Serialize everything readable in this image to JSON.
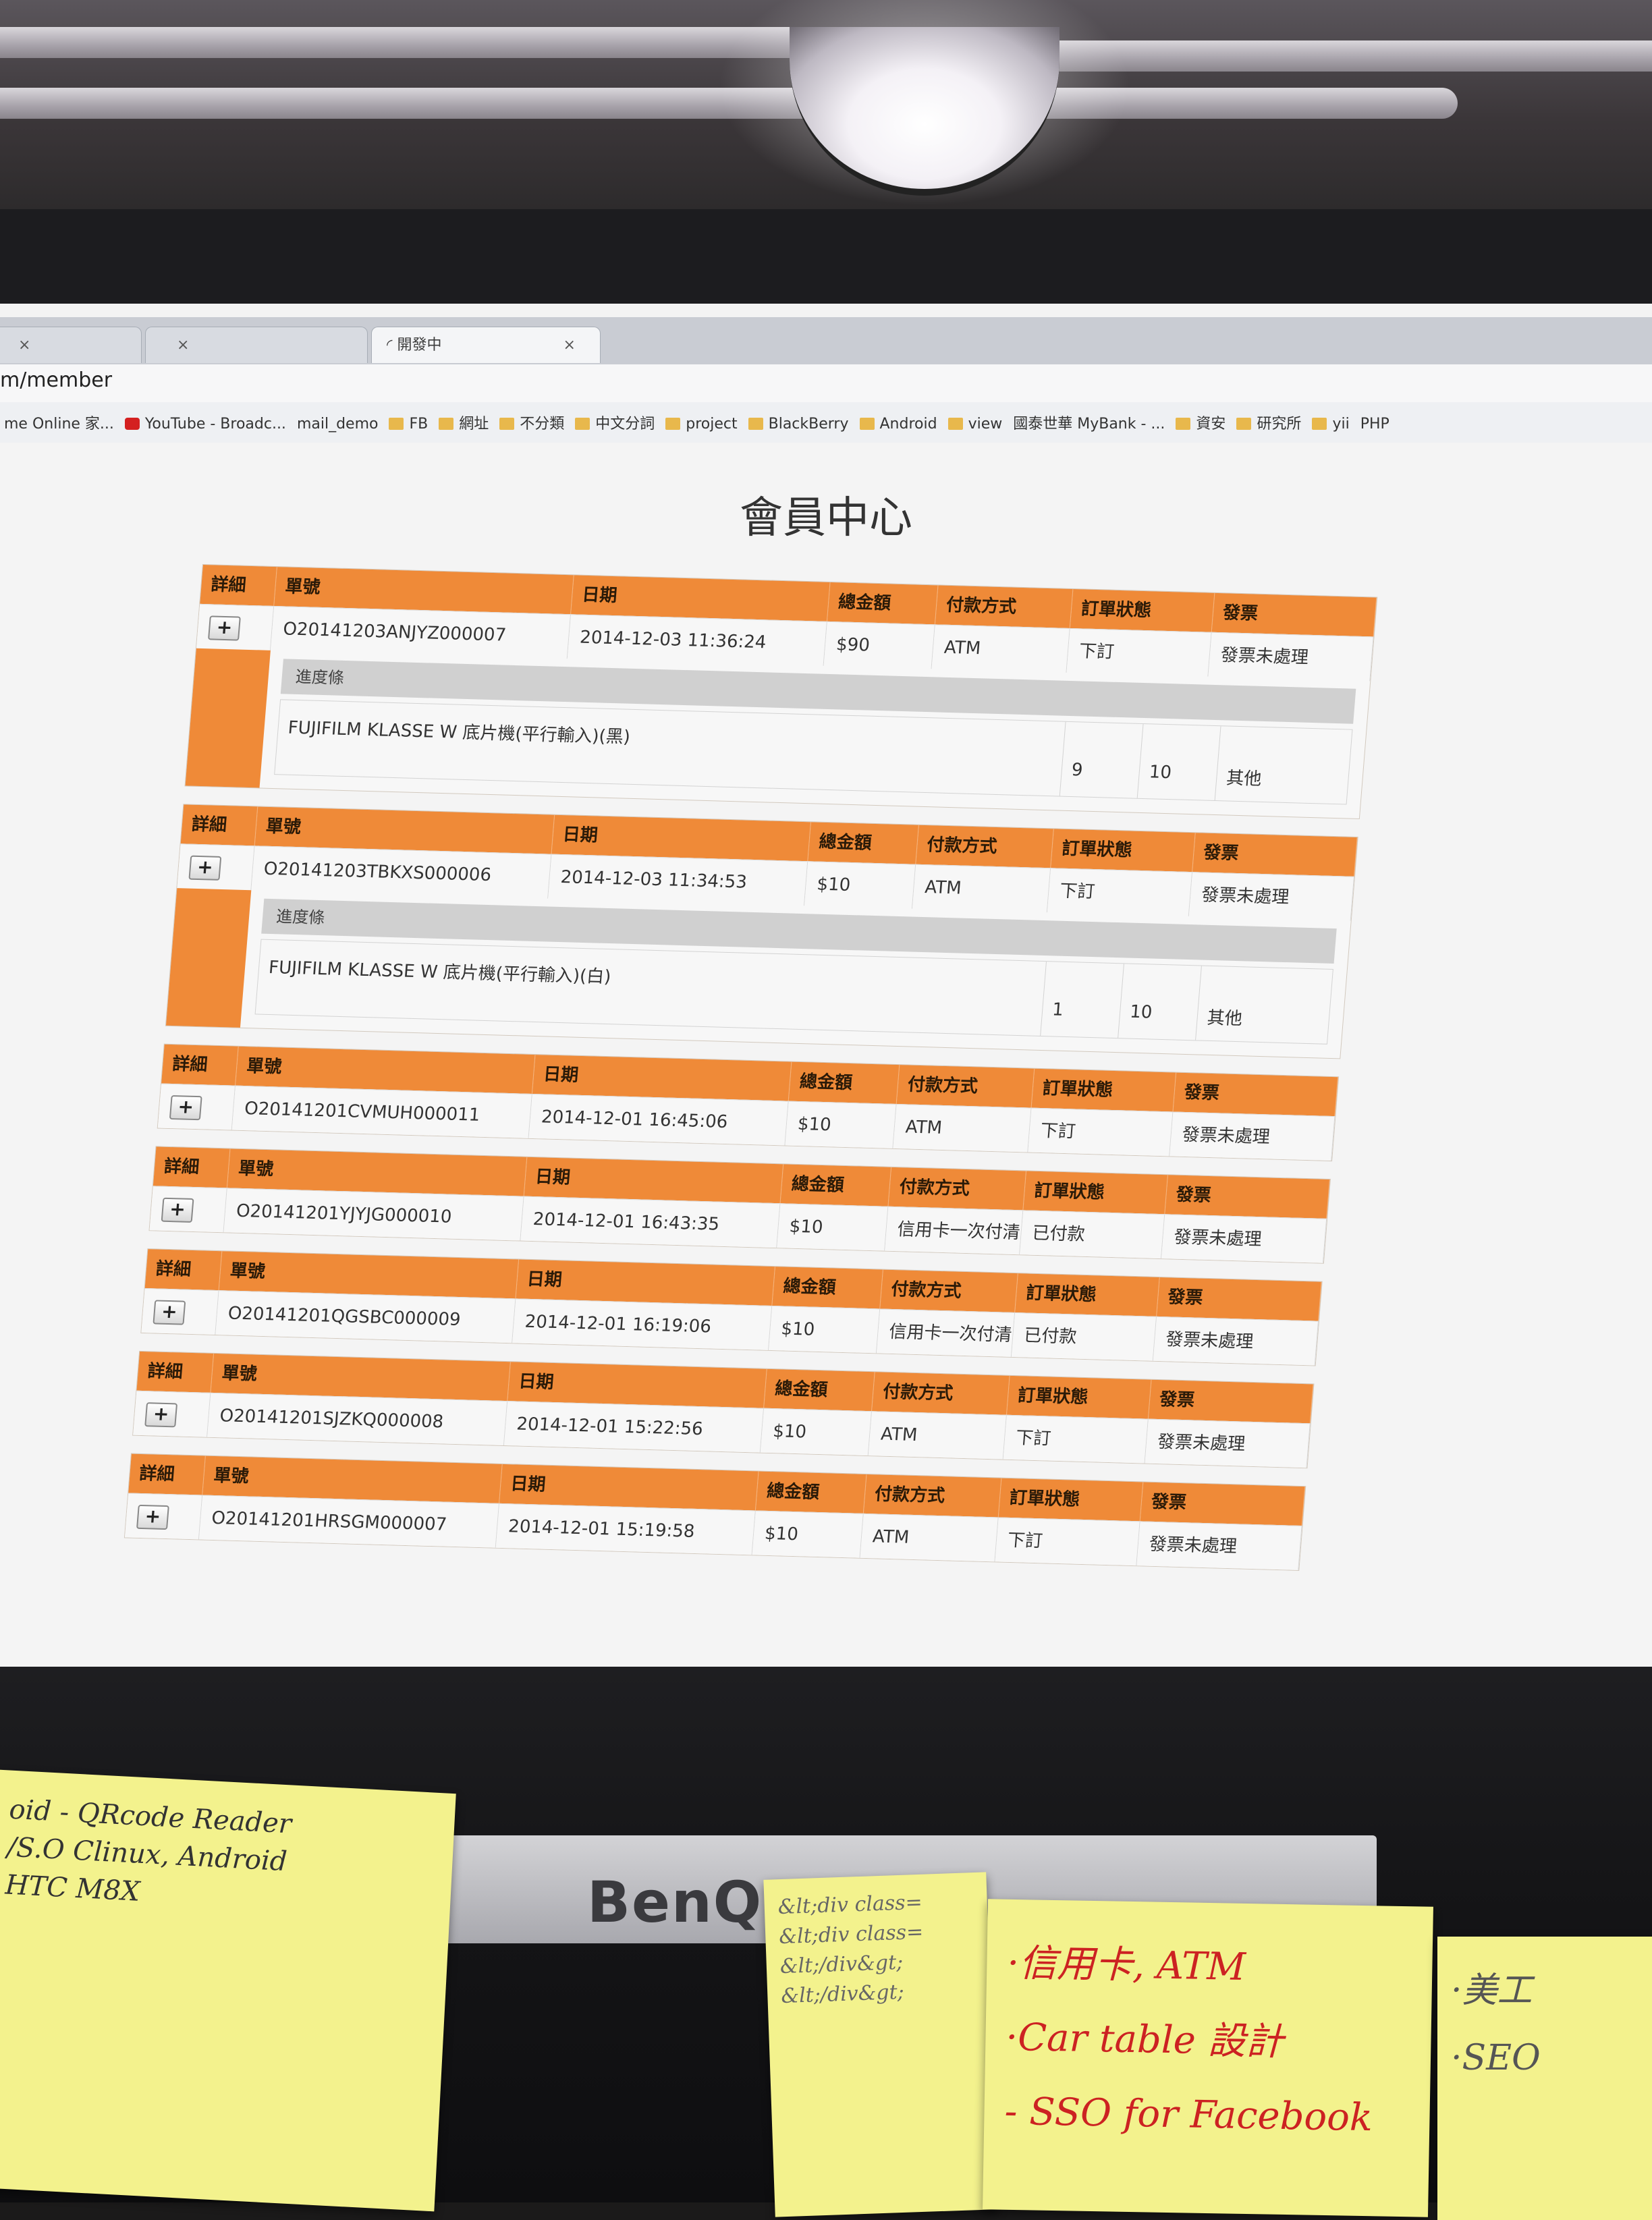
{
  "browser": {
    "tabs": [
      {
        "label": "",
        "active": false
      },
      {
        "label": "",
        "active": false
      },
      {
        "label": "開發中",
        "active": true
      }
    ],
    "url": "m/member",
    "bookmarks": [
      {
        "label": "me Online 家...",
        "icon": "page-icon"
      },
      {
        "label": "YouTube - Broadc...",
        "icon": "youtube-icon"
      },
      {
        "label": "mail_demo",
        "icon": "page-icon"
      },
      {
        "label": "FB",
        "icon": "folder-icon"
      },
      {
        "label": "網址",
        "icon": "folder-icon"
      },
      {
        "label": "不分類",
        "icon": "folder-icon"
      },
      {
        "label": "中文分詞",
        "icon": "folder-icon"
      },
      {
        "label": "project",
        "icon": "folder-icon"
      },
      {
        "label": "BlackBerry",
        "icon": "folder-icon"
      },
      {
        "label": "Android",
        "icon": "folder-icon"
      },
      {
        "label": "view",
        "icon": "folder-icon"
      },
      {
        "label": "國泰世華 MyBank - ...",
        "icon": "page-icon"
      },
      {
        "label": "資安",
        "icon": "folder-icon"
      },
      {
        "label": "研究所",
        "icon": "folder-icon"
      },
      {
        "label": "yii",
        "icon": "folder-icon"
      },
      {
        "label": "PHP",
        "icon": "page-icon"
      }
    ]
  },
  "page": {
    "title": "會員中心",
    "headers": {
      "detail": "詳細",
      "order_no": "單號",
      "date": "日期",
      "total": "總金額",
      "payment": "付款方式",
      "status": "訂單狀態",
      "invoice": "發票"
    },
    "expand_label": "+",
    "progress_label": "進度條",
    "orders": [
      {
        "order_no": "O20141203ANJYZ000007",
        "date": "2014-12-03 11:36:24",
        "total": "$90",
        "payment": "ATM",
        "status": "下訂",
        "invoice": "發票未處理",
        "expanded": true,
        "product": "FUJIFILM KLASSE W 底片機(平行輸入)(黑)",
        "qty": "9",
        "price": "10",
        "note": "其他"
      },
      {
        "order_no": "O20141203TBKXS000006",
        "date": "2014-12-03 11:34:53",
        "total": "$10",
        "payment": "ATM",
        "status": "下訂",
        "invoice": "發票未處理",
        "expanded": true,
        "product": "FUJIFILM KLASSE W 底片機(平行輸入)(白)",
        "qty": "1",
        "price": "10",
        "note": "其他"
      },
      {
        "order_no": "O20141201CVMUH000011",
        "date": "2014-12-01 16:45:06",
        "total": "$10",
        "payment": "ATM",
        "status": "下訂",
        "invoice": "發票未處理",
        "expanded": false
      },
      {
        "order_no": "O20141201YJYJG000010",
        "date": "2014-12-01 16:43:35",
        "total": "$10",
        "payment": "信用卡一次付清",
        "status": "已付款",
        "invoice": "發票未處理",
        "expanded": false
      },
      {
        "order_no": "O20141201QGSBC000009",
        "date": "2014-12-01 16:19:06",
        "total": "$10",
        "payment": "信用卡一次付清",
        "status": "已付款",
        "invoice": "發票未處理",
        "expanded": false
      },
      {
        "order_no": "O20141201SJZKQ000008",
        "date": "2014-12-01 15:22:56",
        "total": "$10",
        "payment": "ATM",
        "status": "下訂",
        "invoice": "發票未處理",
        "expanded": false
      },
      {
        "order_no": "O20141201HRSGM000007",
        "date": "2014-12-01 15:19:58",
        "total": "$10",
        "payment": "ATM",
        "status": "下訂",
        "invoice": "發票未處理",
        "expanded": false
      }
    ]
  },
  "monitor": {
    "brand": "BenQ"
  },
  "notes": [
    {
      "lines": [
        "oid - QRcode Reader",
        "/S.O Clinux, Android",
        "HTC M8X"
      ]
    },
    {
      "lines": [
        "&lt;div class=",
        "&lt;div class=",
        "&lt;/div&gt;",
        "&lt;/div&gt;"
      ]
    },
    {
      "lines": [
        "·信用卡, ATM",
        "·Car table 設計",
        "- SSO for Facebook"
      ]
    },
    {
      "lines": [
        "·美工",
        "·SEO"
      ]
    }
  ]
}
